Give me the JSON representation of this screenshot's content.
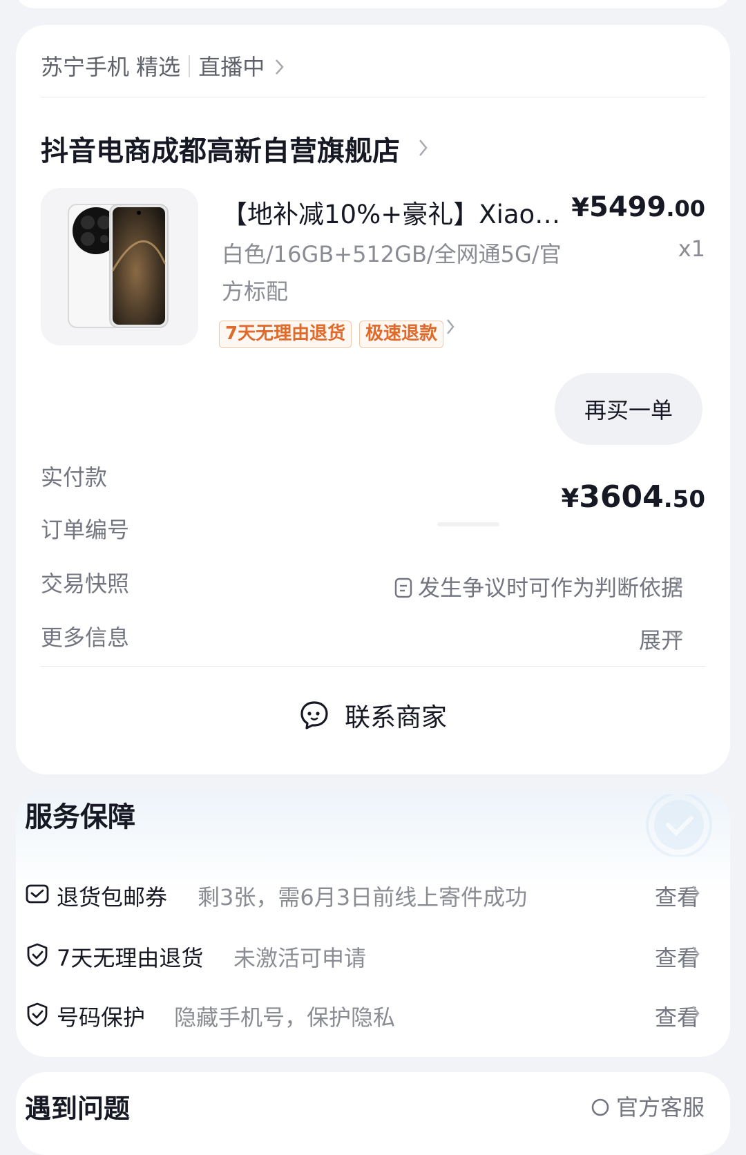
{
  "order": {
    "channel": {
      "source": "苏宁手机 精选",
      "live": "直播中"
    },
    "store_name": "抖音电商成都高新自营旗舰店",
    "product": {
      "title": "【地补减10%+豪礼】Xiao…",
      "price_symbol": "¥",
      "price_integer": "5499",
      "price_decimal": ".00",
      "spec": "白色/16GB+512GB/全网通5G/官方标配",
      "quantity": "x1",
      "tags": [
        "7天无理由退货",
        "极速退款"
      ]
    },
    "buy_again_label": "再买一单",
    "rows": {
      "paid": {
        "label": "实付款",
        "symbol": "¥",
        "integer": "3604",
        "decimal": ".50"
      },
      "order_no": {
        "label": "订单编号"
      },
      "snapshot": {
        "label": "交易快照",
        "value": "发生争议时可作为判断依据"
      },
      "more": {
        "label": "更多信息",
        "value": "展开"
      }
    },
    "contact_label": "联系商家"
  },
  "service": {
    "title": "服务保障",
    "items": [
      {
        "icon": "coupon-icon",
        "name": "退货包邮券",
        "desc": "剩3张，需6月3日前线上寄件成功",
        "action": "查看"
      },
      {
        "icon": "shield-check-icon",
        "name": "7天无理由退货",
        "desc": "未激活可申请",
        "action": "查看"
      },
      {
        "icon": "shield-check-icon",
        "name": "号码保护",
        "desc": "隐藏手机号，保护隐私",
        "action": "查看"
      }
    ]
  },
  "issue": {
    "title": "遇到问题",
    "official_service": "官方客服"
  },
  "colors": {
    "page_bg": "#f2f3f7",
    "card_bg": "#ffffff",
    "tag_text": "#e06a2b",
    "tag_border": "#f0c6a8",
    "secondary_text": "#737680"
  }
}
